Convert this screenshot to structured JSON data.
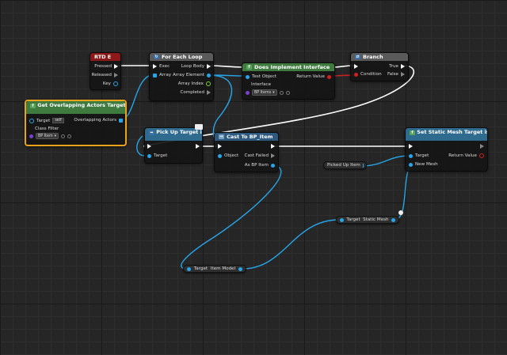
{
  "nodes": {
    "key_event": {
      "title": "RTD E",
      "pressed": "Pressed",
      "released": "Released",
      "key": "Key"
    },
    "for_each": {
      "title": "For Each Loop",
      "exec": "Exec",
      "array": "Array",
      "loop_body": "Loop Body",
      "array_element": "Array Element",
      "array_index": "Array Index",
      "completed": "Completed"
    },
    "does_implement": {
      "title": "Does Implement Interface",
      "test_object": "Test Object",
      "interface": "Interface",
      "interface_value": "BP Items",
      "return_value": "Return Value"
    },
    "branch": {
      "title": "Branch",
      "condition": "Condition",
      "true_label": "True",
      "false_label": "False"
    },
    "get_overlapping": {
      "title": "Get Overlapping Actors",
      "subtitle": "Target is Actor",
      "target": "Target",
      "self_value": "self",
      "class_filter": "Class Filter",
      "class_value": "BP Item",
      "overlapping_actors": "Overlapping Actors"
    },
    "pick_up": {
      "title": "Pick Up",
      "subtitle": "Target is BP Items",
      "target": "Target"
    },
    "cast": {
      "title": "Cast To BP_Item",
      "object": "Object",
      "cast_failed": "Cast Failed",
      "as_bp_item": "As BP Item"
    },
    "set_static_mesh": {
      "title": "Set Static Mesh",
      "subtitle": "Target is Static Mesh Component",
      "target": "Target",
      "new_mesh": "New Mesh",
      "return_value": "Return Value"
    },
    "picked_up_item": {
      "label": "Picked Up Item"
    },
    "static_mesh_getter": {
      "target": "Target",
      "value": "Static Mesh"
    },
    "item_model_getter": {
      "target": "Target",
      "value": "Item Model"
    }
  },
  "colors": {
    "event_header": "#8c1a1a",
    "macro_header": "#595959",
    "interface_header": "#3f7a3f",
    "function_header": "#2f6a8f",
    "cast_header": "#2e5a80",
    "exec_wire": "#ffffff",
    "object_wire": "#27a5e8",
    "selection": "#e9a21a",
    "background": "#262626"
  },
  "icons": [
    "event-icon",
    "foreach-icon",
    "interface-function-icon",
    "branch-icon",
    "function-icon",
    "cast-icon",
    "envelope-icon"
  ]
}
